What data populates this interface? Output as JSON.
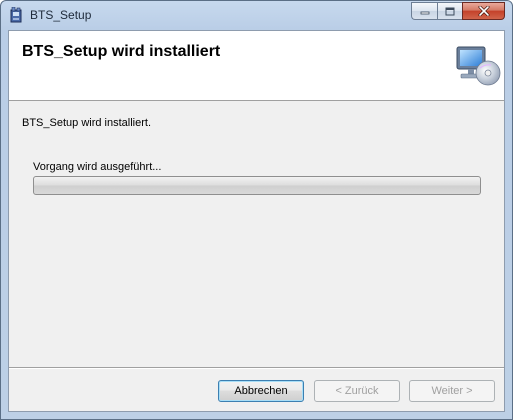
{
  "window": {
    "title": "BTS_Setup",
    "icon": "installer-icon",
    "caption_buttons": [
      "minimize-icon",
      "maximize-icon",
      "close-icon"
    ]
  },
  "header": {
    "title": "BTS_Setup wird installiert",
    "icon": "computer-cd-icon"
  },
  "main": {
    "status_text": "BTS_Setup wird installiert.",
    "progress_label": "Vorgang wird ausgeführt...",
    "progress_fraction": 0.0
  },
  "buttons": {
    "cancel_label": "Abbrechen",
    "back_label": "< Zurück",
    "next_label": "Weiter >"
  },
  "colors": {
    "header_background": "#ffffff",
    "dialog_background": "#f0f0f0",
    "default_button_border": "#3c7fb1"
  }
}
